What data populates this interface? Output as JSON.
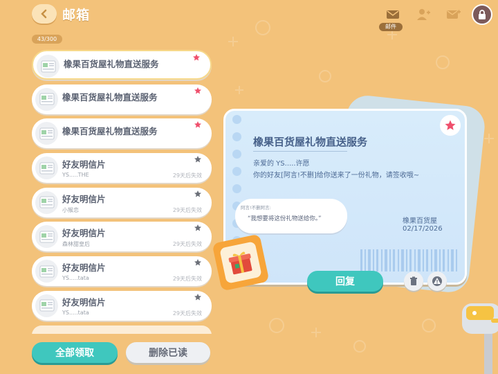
{
  "header": {
    "title": "邮箱",
    "mail_tab_label": "邮件"
  },
  "counter": "43/300",
  "mails": [
    {
      "title": "橡果百货屋礼物直送服务",
      "sub": "",
      "expire": "",
      "star": "red",
      "selected": true
    },
    {
      "title": "橡果百货屋礼物直送服务",
      "sub": "",
      "expire": "",
      "star": "red",
      "selected": false
    },
    {
      "title": "橡果百货屋礼物直送服务",
      "sub": "",
      "expire": "",
      "star": "red",
      "selected": false
    },
    {
      "title": "好友明信片",
      "sub": "YS.....THE",
      "expire": "29天后失效",
      "star": "gray",
      "selected": false
    },
    {
      "title": "好友明信片",
      "sub": "小猴恋",
      "expire": "29天后失效",
      "star": "gray",
      "selected": false
    },
    {
      "title": "好友明信片",
      "sub": "森林甜皇后",
      "expire": "29天后失效",
      "star": "gray",
      "selected": false
    },
    {
      "title": "好友明信片",
      "sub": "YS.....tata",
      "expire": "29天后失效",
      "star": "gray",
      "selected": false
    },
    {
      "title": "好友明信片",
      "sub": "YS.....tata",
      "expire": "29天后失效",
      "star": "gray",
      "selected": false
    }
  ],
  "buttons": {
    "claim_all": "全部领取",
    "delete_read": "删除已读",
    "reply": "回复"
  },
  "letter": {
    "title": "橡果百货屋礼物直送服务",
    "greeting": "亲爱的 YS.....许愿",
    "body": "你的好友[阿言!不删]给你送来了一份礼物，请签收哦~",
    "sender": "橡果百货屋",
    "date": "02/17/2026",
    "bubble_name": "阿言!不删阿言:",
    "bubble_message": "“我想要将这份礼物送给你。”"
  },
  "colors": {
    "background": "#f3c27a",
    "accent": "#3fc7be",
    "star_red": "#ef4f6c",
    "star_gray": "#6b6f78"
  }
}
